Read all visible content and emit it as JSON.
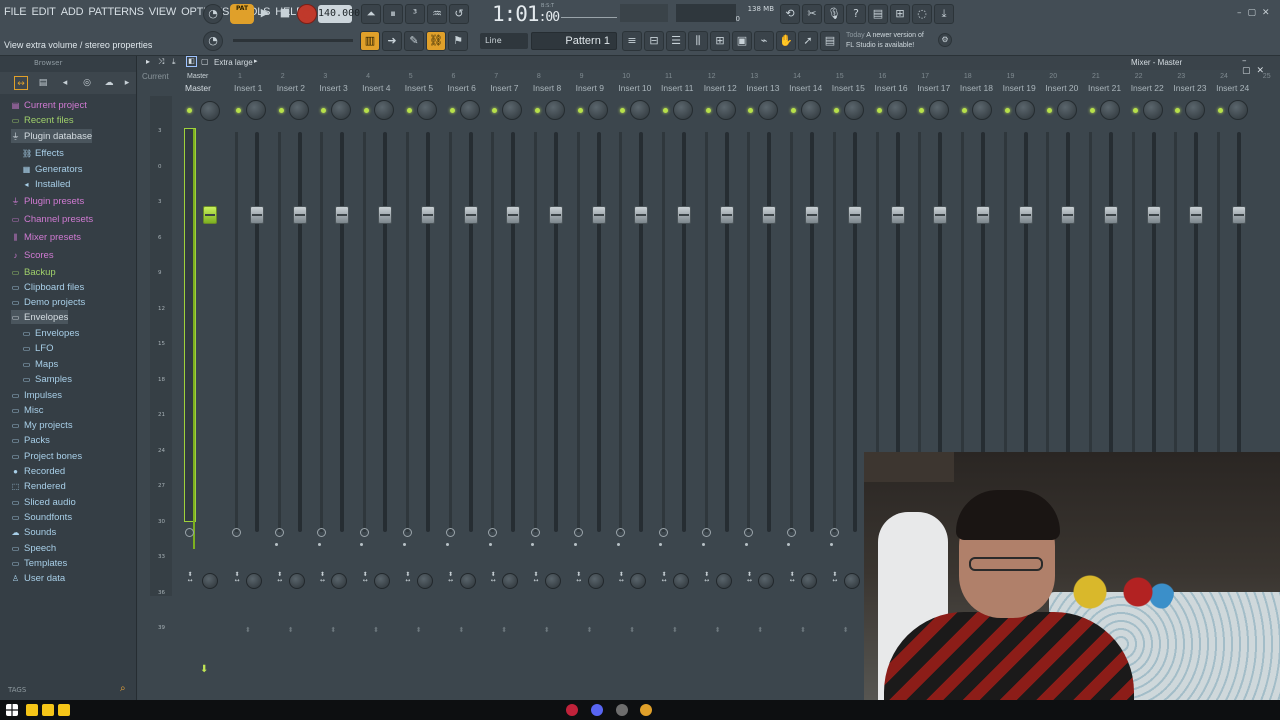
{
  "menu": [
    "FILE",
    "EDIT",
    "ADD",
    "PATTERNS",
    "VIEW",
    "OPTIONS",
    "TOOLS",
    "HELP"
  ],
  "hint": "View extra volume / stereo properties",
  "transport": {
    "pat_badge": "PAT",
    "tempo": "140.000",
    "time_main": "1:01",
    "time_sub": "00",
    "time_mode": "B:S:T",
    "memory": "138 MB",
    "cpu_a": "1",
    "cpu_b": "0"
  },
  "snap": "Line",
  "pattern": "Pattern 1",
  "news": {
    "when": "Today",
    "line1": "A newer version of",
    "line2": "FL Studio is available!"
  },
  "browser": {
    "header": "Browser",
    "tags": "TAGS",
    "items": [
      {
        "label": "Current project",
        "icon": "document-icon",
        "color": "pink"
      },
      {
        "label": "Recent files",
        "icon": "folder-icon",
        "color": "green"
      },
      {
        "label": "Plugin database",
        "icon": "plug-icon",
        "color": "white"
      },
      {
        "label": "Effects",
        "icon": "chain-icon",
        "color": "blue"
      },
      {
        "label": "Generators",
        "icon": "grid-icon",
        "color": "blue"
      },
      {
        "label": "Installed",
        "icon": "speaker-icon",
        "color": "blue"
      },
      {
        "label": "Plugin presets",
        "icon": "plug-icon",
        "color": "pink"
      },
      {
        "label": "Channel presets",
        "icon": "folder-icon",
        "color": "pink"
      },
      {
        "label": "Mixer presets",
        "icon": "mixer-icon",
        "color": "pink"
      },
      {
        "label": "Scores",
        "icon": "note-icon",
        "color": "pink"
      },
      {
        "label": "Backup",
        "icon": "folder-icon",
        "color": "green"
      },
      {
        "label": "Clipboard files",
        "icon": "folder-icon",
        "color": "blue"
      },
      {
        "label": "Demo projects",
        "icon": "folder-icon",
        "color": "blue"
      },
      {
        "label": "Envelopes",
        "icon": "folder-icon",
        "color": "white"
      },
      {
        "label": "Envelopes",
        "icon": "folder-icon",
        "color": "blue"
      },
      {
        "label": "LFO",
        "icon": "folder-icon",
        "color": "blue"
      },
      {
        "label": "Maps",
        "icon": "folder-icon",
        "color": "blue"
      },
      {
        "label": "Samples",
        "icon": "folder-icon",
        "color": "blue"
      },
      {
        "label": "Impulses",
        "icon": "folder-icon",
        "color": "blue"
      },
      {
        "label": "Misc",
        "icon": "folder-icon",
        "color": "blue"
      },
      {
        "label": "My projects",
        "icon": "folder-icon",
        "color": "blue"
      },
      {
        "label": "Packs",
        "icon": "folder-icon",
        "color": "blue"
      },
      {
        "label": "Project bones",
        "icon": "folder-icon",
        "color": "blue"
      },
      {
        "label": "Recorded",
        "icon": "mic-icon",
        "color": "blue"
      },
      {
        "label": "Rendered",
        "icon": "render-icon",
        "color": "blue"
      },
      {
        "label": "Sliced audio",
        "icon": "folder-icon",
        "color": "blue"
      },
      {
        "label": "Soundfonts",
        "icon": "folder-icon",
        "color": "blue"
      },
      {
        "label": "Sounds",
        "icon": "cloud-icon",
        "color": "blue"
      },
      {
        "label": "Speech",
        "icon": "folder-icon",
        "color": "blue"
      },
      {
        "label": "Templates",
        "icon": "folder-icon",
        "color": "blue"
      },
      {
        "label": "User data",
        "icon": "user-icon",
        "color": "blue"
      }
    ]
  },
  "mixer": {
    "title": "Mixer - Master",
    "preset": "Extra large",
    "current_label": "Current",
    "master_name": "Master",
    "master_tag": "Master",
    "db_scale": [
      "3",
      "0",
      "3",
      "6",
      "9",
      "12",
      "15",
      "18",
      "21",
      "24",
      "27",
      "30",
      "33",
      "36",
      "39"
    ],
    "inserts": [
      {
        "num": "1",
        "name": "Insert 1"
      },
      {
        "num": "2",
        "name": "Insert 2"
      },
      {
        "num": "3",
        "name": "Insert 3"
      },
      {
        "num": "4",
        "name": "Insert 4"
      },
      {
        "num": "5",
        "name": "Insert 5"
      },
      {
        "num": "6",
        "name": "Insert 6"
      },
      {
        "num": "7",
        "name": "Insert 7"
      },
      {
        "num": "8",
        "name": "Insert 8"
      },
      {
        "num": "9",
        "name": "Insert 9"
      },
      {
        "num": "10",
        "name": "Insert 10"
      },
      {
        "num": "11",
        "name": "Insert 11"
      },
      {
        "num": "12",
        "name": "Insert 12"
      },
      {
        "num": "13",
        "name": "Insert 13"
      },
      {
        "num": "14",
        "name": "Insert 14"
      },
      {
        "num": "15",
        "name": "Insert 15"
      },
      {
        "num": "16",
        "name": "Insert 16"
      },
      {
        "num": "17",
        "name": "Insert 17"
      },
      {
        "num": "18",
        "name": "Insert 18"
      },
      {
        "num": "19",
        "name": "Insert 19"
      },
      {
        "num": "20",
        "name": "Insert 20"
      },
      {
        "num": "21",
        "name": "Insert 21"
      },
      {
        "num": "22",
        "name": "Insert 22"
      },
      {
        "num": "23",
        "name": "Insert 23"
      },
      {
        "num": "24",
        "name": "Insert 24"
      },
      {
        "num": "25",
        "name": ""
      }
    ]
  },
  "colors": {
    "accent": "#b7e04a",
    "orange": "#e0a02a",
    "bg": "#3c464d"
  }
}
